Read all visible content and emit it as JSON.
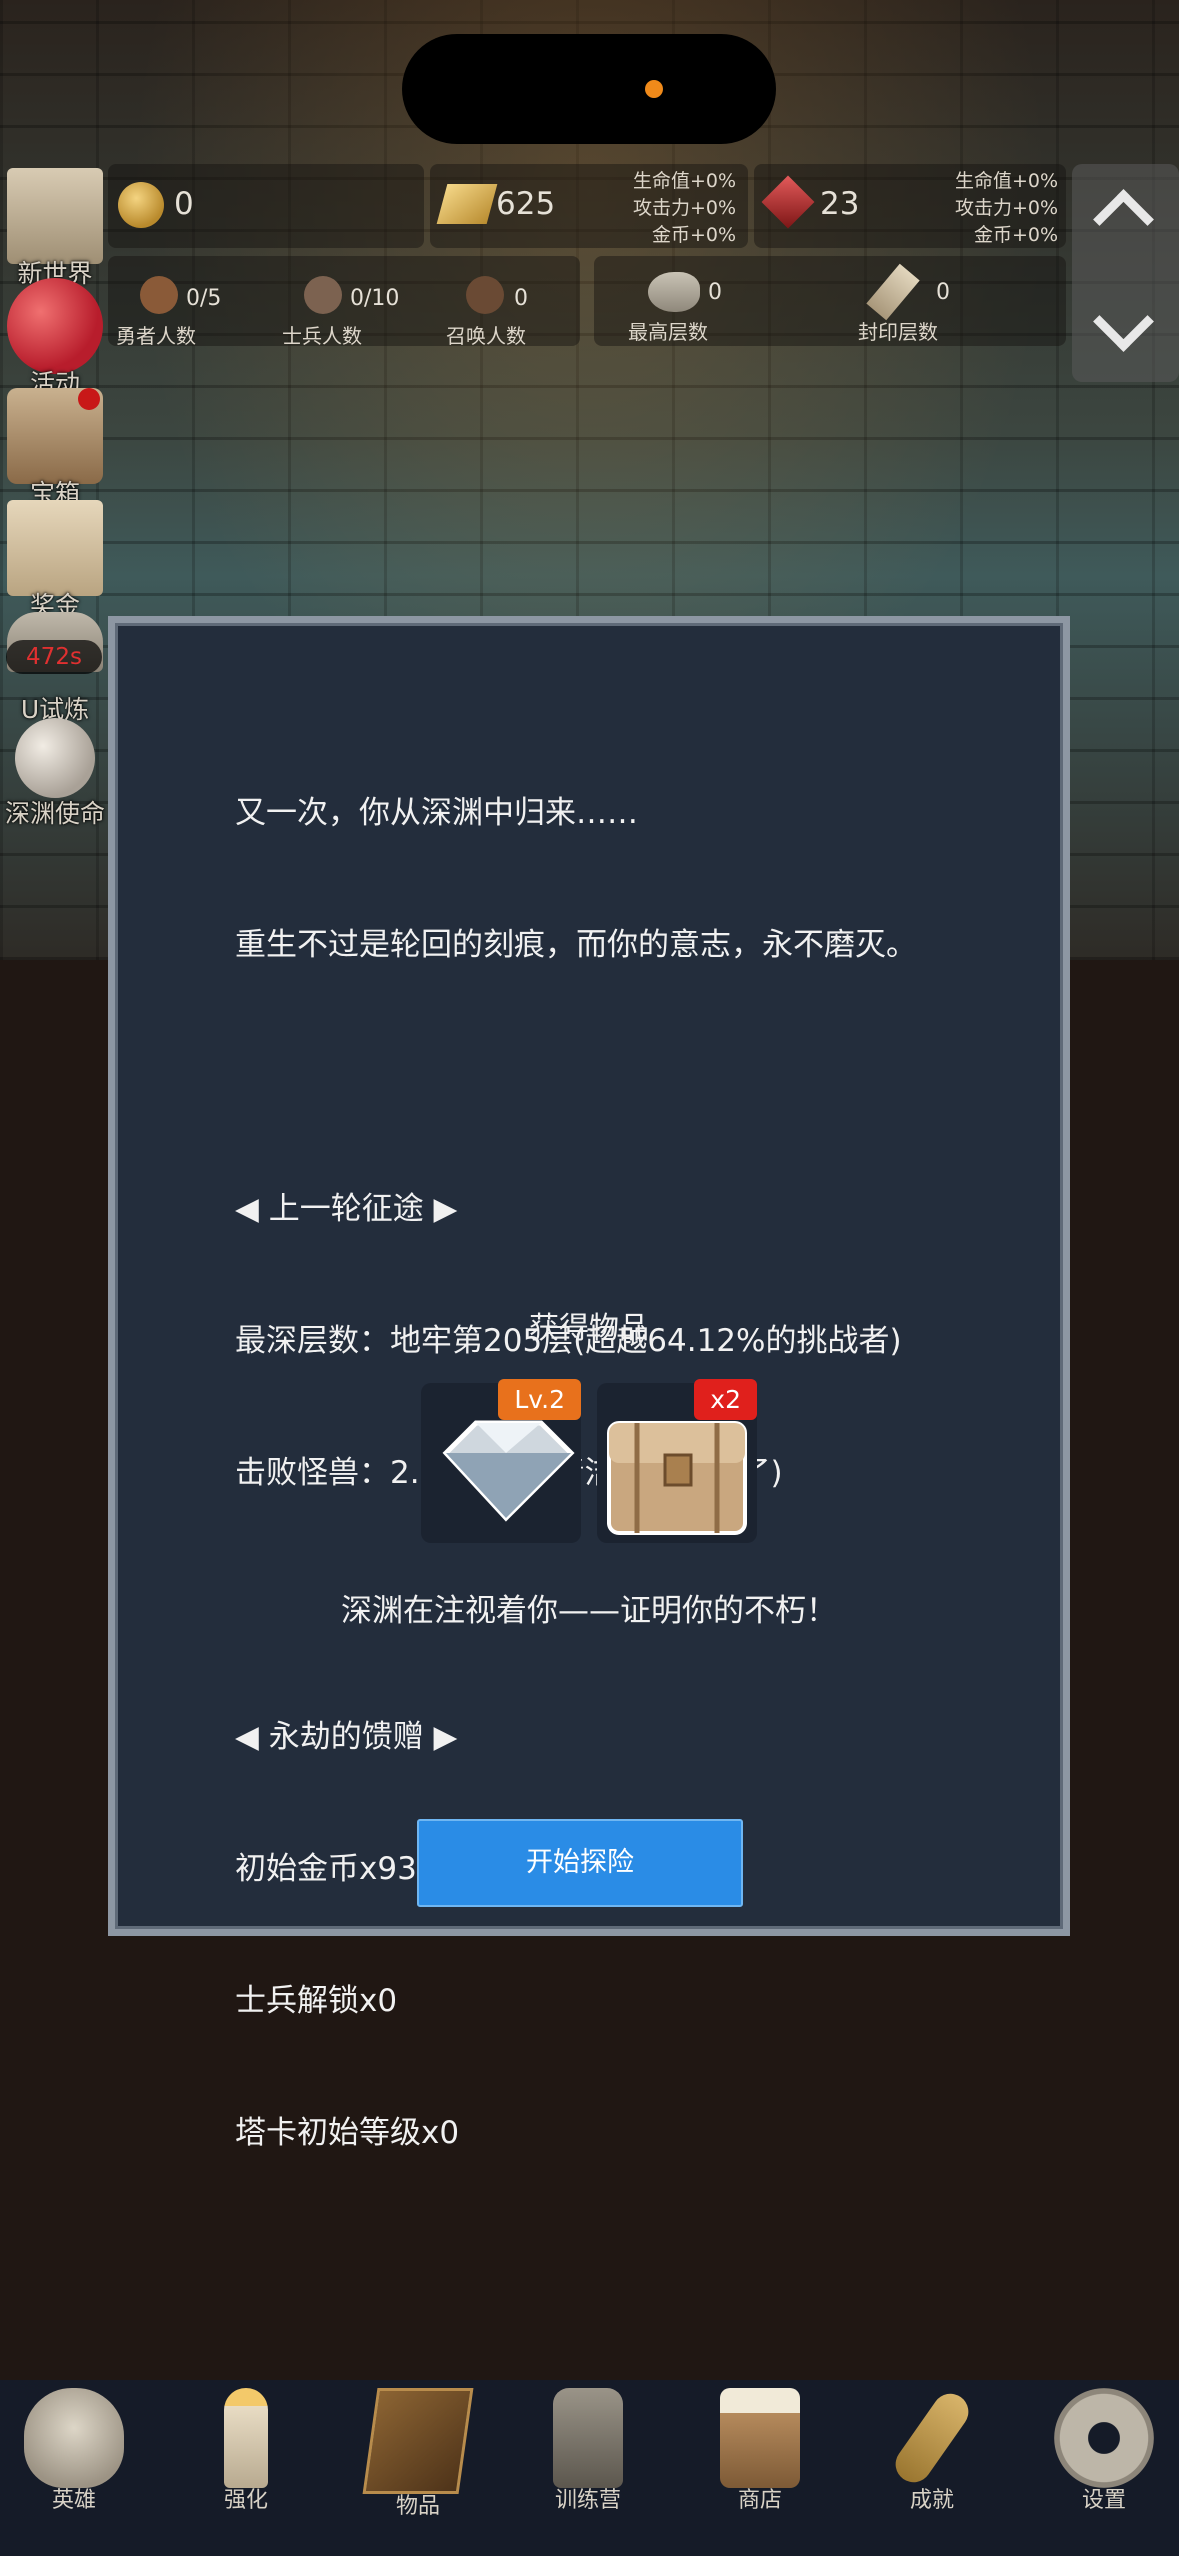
{
  "sidebar": {
    "items": [
      {
        "label": "新世界",
        "icon": "map-scroll-icon"
      },
      {
        "label": "活动",
        "icon": "heart-icon"
      },
      {
        "label": "宝箱",
        "icon": "chest-icon"
      },
      {
        "label": "奖金",
        "icon": "envelope-icon"
      },
      {
        "label": "U试炼",
        "icon": "trial-icon",
        "timer": "472s"
      },
      {
        "label": "深渊使命",
        "icon": "orb-icon"
      }
    ]
  },
  "resources": {
    "gold": "0",
    "gold_bar": "625",
    "gem": "23",
    "bonus_lines": [
      "生命值+0%",
      "攻击力+0%",
      "金币+0%"
    ]
  },
  "stats": [
    {
      "value": "0/5",
      "label": "勇者人数",
      "icon": "hero-head-icon"
    },
    {
      "value": "0/10",
      "label": "士兵人数",
      "icon": "soldier-head-icon"
    },
    {
      "value": "0",
      "label": "召唤人数",
      "icon": "summon-head-icon"
    },
    {
      "value": "0",
      "label": "最高层数",
      "icon": "stone-icon"
    },
    {
      "value": "0",
      "label": "封印层数",
      "icon": "scroll-icon"
    }
  ],
  "modal": {
    "lines": [
      "又一次，你从深渊中归来……",
      "重生不过是轮回的刻痕，而你的意志，永不磨灭。",
      "",
      "◀ 上一轮征途 ▶",
      "最深层数：地牢第205层(超越64.12%的挑战者)",
      "击败怪兽：2.71K(地牢清洁工认识你了)",
      "",
      "◀ 永劫的馈赠 ▶",
      "初始金币x936",
      "士兵解锁x0",
      "塔卡初始等级x0"
    ],
    "items_title": "获得物品",
    "items": [
      {
        "icon": "diamond-icon",
        "badge": "Lv.2",
        "badge_color": "#e8711c"
      },
      {
        "icon": "treasure-chest-icon",
        "badge": "x2",
        "badge_color": "#e0201c"
      }
    ],
    "tagline": "深渊在注视着你——证明你的不朽！",
    "start_button": "开始探险"
  },
  "bottom_nav": [
    {
      "label": "英雄",
      "icon": "skull-icon"
    },
    {
      "label": "强化",
      "icon": "candle-icon"
    },
    {
      "label": "物品",
      "icon": "book-icon"
    },
    {
      "label": "训练营",
      "icon": "lantern-icon"
    },
    {
      "label": "商店",
      "icon": "mug-icon"
    },
    {
      "label": "成就",
      "icon": "key-icon"
    },
    {
      "label": "设置",
      "icon": "gear-icon"
    }
  ]
}
